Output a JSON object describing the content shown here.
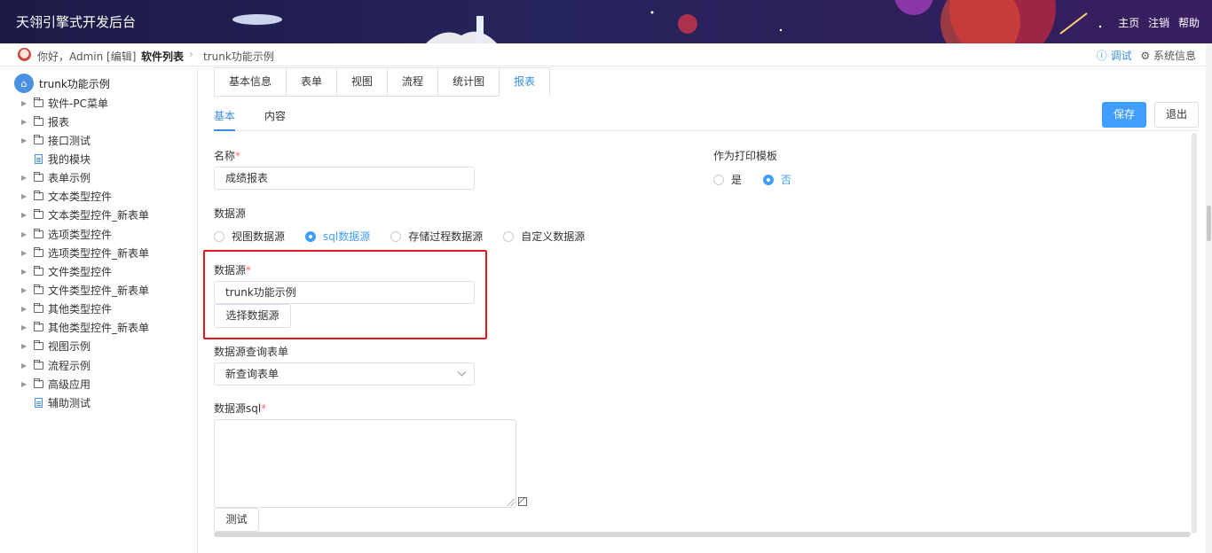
{
  "header": {
    "title": "天翎引擎式开发后台",
    "links": [
      "主页",
      "注销",
      "帮助"
    ]
  },
  "breadcrumb": {
    "greeting": "你好，Admin [编辑]",
    "items": [
      "软件列表",
      "trunk功能示例"
    ],
    "debug": "ⓘ 调试",
    "sysinfo": "⚙ 系统信息"
  },
  "sidebar": {
    "root": "trunk功能示例",
    "items": [
      {
        "label": "软件-PC菜单",
        "type": "folder"
      },
      {
        "label": "报表",
        "type": "folder"
      },
      {
        "label": "接口测试",
        "type": "folder"
      },
      {
        "label": "我的模块",
        "type": "file"
      },
      {
        "label": "表单示例",
        "type": "folder"
      },
      {
        "label": "文本类型控件",
        "type": "folder"
      },
      {
        "label": "文本类型控件_新表单",
        "type": "folder"
      },
      {
        "label": "选项类型控件",
        "type": "folder"
      },
      {
        "label": "选项类型控件_新表单",
        "type": "folder"
      },
      {
        "label": "文件类型控件",
        "type": "folder"
      },
      {
        "label": "文件类型控件_新表单",
        "type": "folder"
      },
      {
        "label": "其他类型控件",
        "type": "folder"
      },
      {
        "label": "其他类型控件_新表单",
        "type": "folder"
      },
      {
        "label": "视图示例",
        "type": "folder"
      },
      {
        "label": "流程示例",
        "type": "folder"
      },
      {
        "label": "高级应用",
        "type": "folder"
      },
      {
        "label": "辅助测试",
        "type": "file"
      }
    ]
  },
  "tabs": [
    "基本信息",
    "表单",
    "视图",
    "流程",
    "统计图",
    "报表"
  ],
  "active_tab": "报表",
  "subtabs": [
    "基本",
    "内容"
  ],
  "buttons": {
    "save": "保存",
    "exit": "退出"
  },
  "form": {
    "name_label": "名称",
    "name_value": "成绩报表",
    "print_label": "作为打印模板",
    "print_options": [
      "是",
      "否"
    ],
    "print_selected": "否",
    "datasource_label": "数据源",
    "datasource_options": [
      "视图数据源",
      "sql数据源",
      "存储过程数据源",
      "自定义数据源"
    ],
    "datasource_selected": "sql数据源",
    "ds_label": "数据源",
    "ds_value": "trunk功能示例",
    "ds_button": "选择数据源",
    "query_form_label": "数据源查询表单",
    "query_form_value": "新查询表单",
    "sql_label": "数据源sql",
    "sql_value": "",
    "test_button": "测试"
  }
}
